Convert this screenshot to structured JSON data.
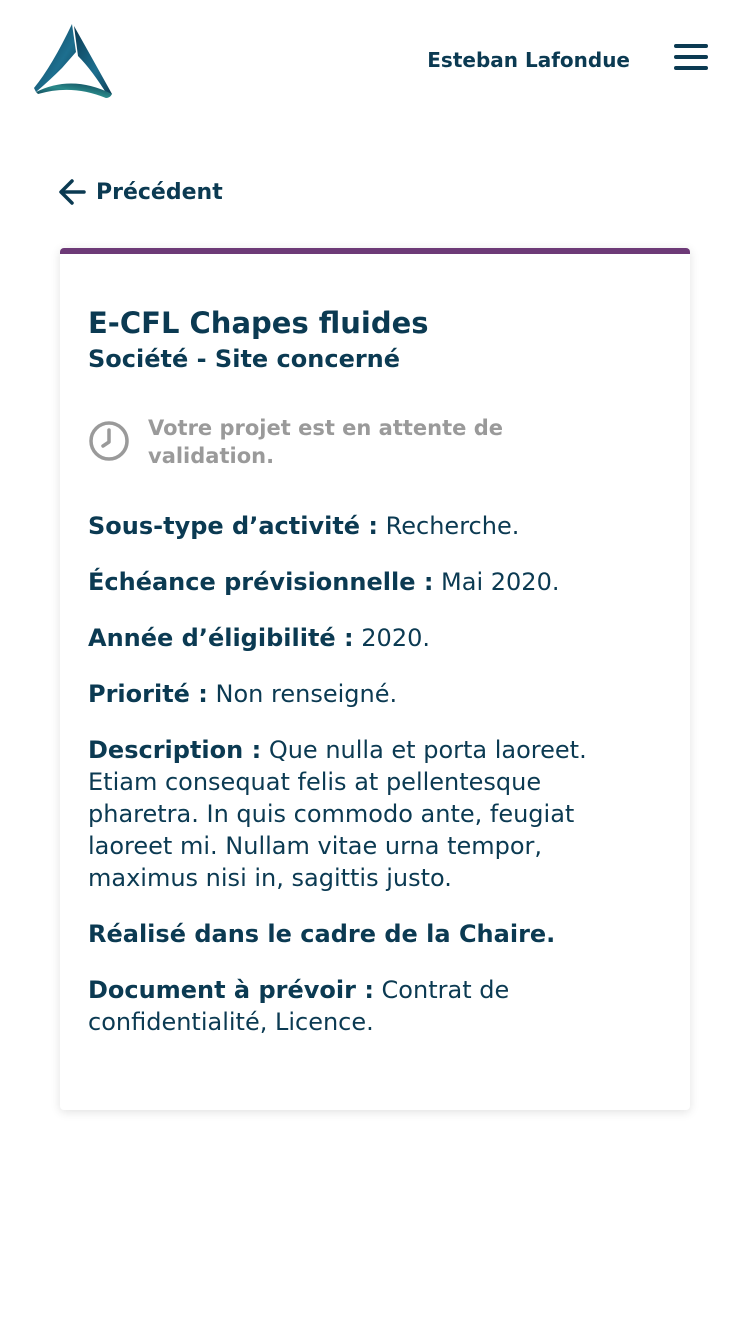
{
  "header": {
    "user_name": "Esteban Lafondue",
    "logo_icon": "triangle-logo-icon",
    "menu_icon": "hamburger-menu-icon"
  },
  "nav": {
    "back_label": "Précédent",
    "back_icon": "arrow-left-icon"
  },
  "project": {
    "title": "E-CFL Chapes fluides",
    "subtitle": "Société - Site concerné",
    "status_text": "Votre projet est en attente de validation.",
    "status_icon": "clock-icon",
    "fields": {
      "subtype_label": "Sous-type d’activité :",
      "subtype_value": " Recherche.",
      "deadline_label": "Échéance prévisionnelle :",
      "deadline_value": " Mai 2020.",
      "eligibility_label": "Année d’éligibilité :",
      "eligibility_value": " 2020.",
      "priority_label": "Priorité :",
      "priority_value": " Non renseigné.",
      "description_label": "Description :",
      "description_value": " Que nulla et porta laoreet. Etiam consequat felis at pellentesque pharetra. In quis commodo ante, feugiat laoreet mi. Nullam vitae urna tempor, maximus nisi in, sagittis justo.",
      "chair_note": "Réalisé dans le cadre de la Chaire.",
      "documents_label": "Document à prévoir :",
      "documents_value": " Contrat de confidentialité, Licence."
    }
  },
  "colors": {
    "primary": "#0b3a52",
    "accent_border": "#6d3a77",
    "muted": "#9a9a9a"
  }
}
